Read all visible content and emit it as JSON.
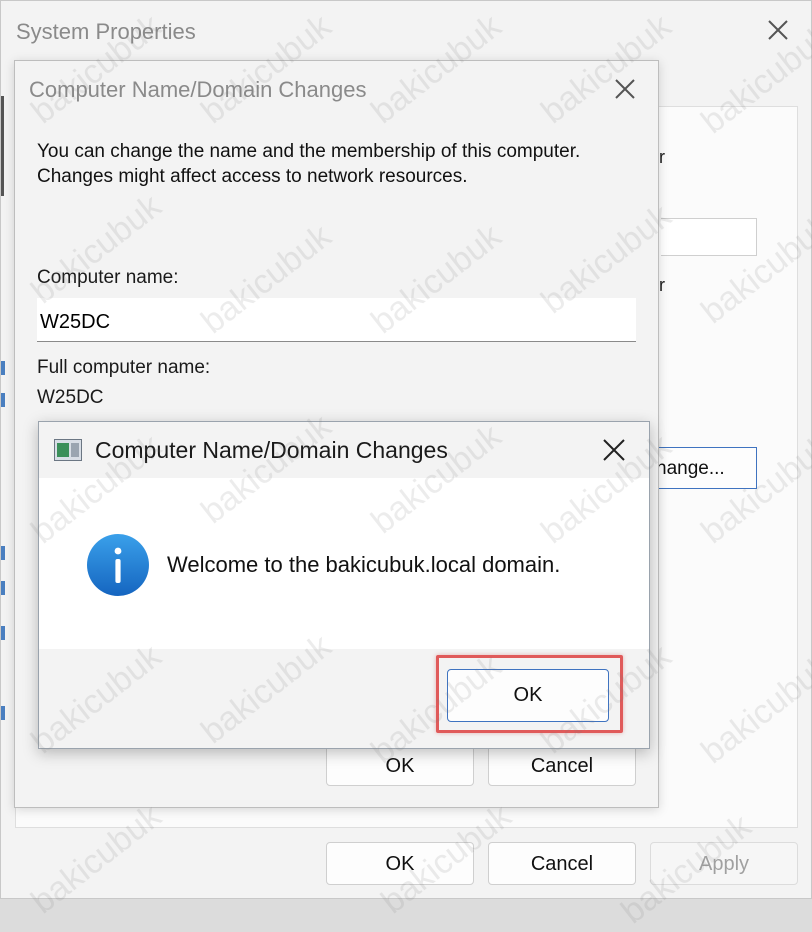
{
  "system_properties": {
    "title": "System Properties",
    "fragment_r1": "r",
    "fragment_r2": "r",
    "change_button_fragment": "hange...",
    "ok_label": "OK",
    "cancel_label": "Cancel",
    "apply_label": "Apply"
  },
  "name_dialog": {
    "title": "Computer Name/Domain Changes",
    "description": "You can change the name and the membership of this computer. Changes might affect access to network resources.",
    "computer_name_label": "Computer name:",
    "computer_name_value": "W25DC",
    "full_name_label": "Full computer name:",
    "full_name_value": "W25DC",
    "ok_label": "OK",
    "cancel_label": "Cancel"
  },
  "message_box": {
    "title": "Computer Name/Domain Changes",
    "message": "Welcome to the bakicubuk.local domain.",
    "ok_label": "OK",
    "icon": "info-icon"
  },
  "watermark": "bakicubuk",
  "colors": {
    "accent_border": "#3f73c0",
    "highlight": "#e05a5a",
    "info_icon": "#1e7fd6"
  }
}
